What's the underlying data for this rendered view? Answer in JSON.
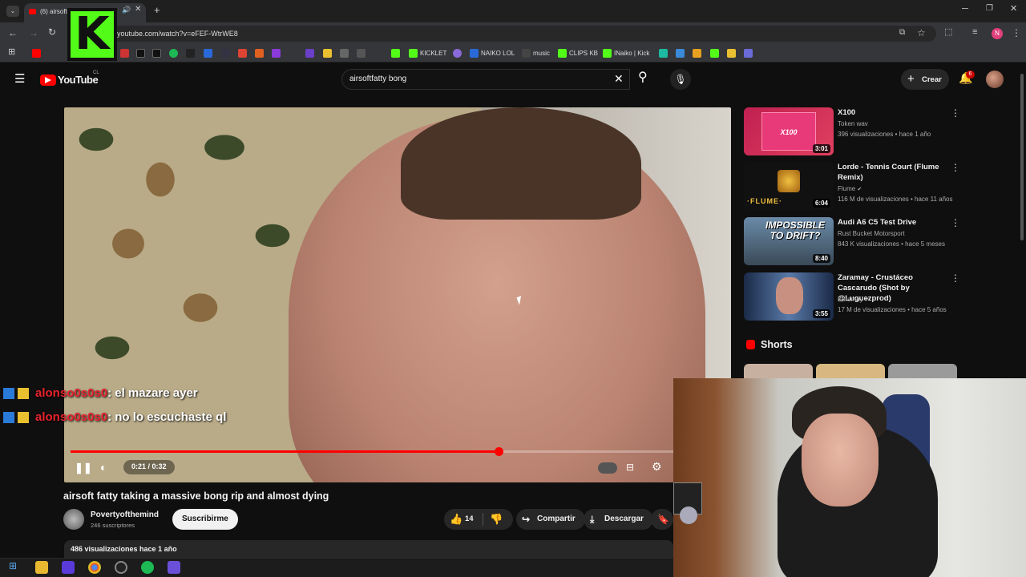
{
  "browser": {
    "tab_title": "(6) airsoft fatty taking",
    "url": "youtube.com/watch?v=eFEF-WtrWE8",
    "avatar_letter": "N",
    "bookmarks": [
      "KICKLET",
      "NAIKO LOL",
      "music",
      "CLIPS KB",
      "INaiko | Kick"
    ]
  },
  "youtube": {
    "logo_text": "YouTube",
    "logo_region": "CL",
    "search_query": "airsoftfatty bong",
    "create_label": "Crear",
    "notification_count": "6"
  },
  "player": {
    "time_display": "0:21 / 0:32",
    "progress_fraction": 0.71
  },
  "chat": [
    {
      "user": "alonso0s0s0",
      "message": ": el mazare ayer"
    },
    {
      "user": "alonso0s0s0",
      "message": ": no lo escuchaste ql"
    }
  ],
  "video": {
    "title": "airsoft fatty taking a massive bong rip and almost dying",
    "channel": "Povertyofthemind",
    "subscribers": "246 suscriptores",
    "subscribe_label": "Suscribirme",
    "likes": "14",
    "share_label": "Compartir",
    "download_label": "Descargar",
    "views_line": "486 visualizaciones  hace 1 año"
  },
  "recommendations": [
    {
      "title": "X100",
      "channel": "Token wav",
      "meta": "396 visualizaciones • hace 1 año",
      "duration": "3:01",
      "thumb_text": "X100"
    },
    {
      "title": "Lorde - Tennis Court (Flume Remix)",
      "channel": "Flume",
      "meta": "116 M de visualizaciones • hace 11 años",
      "duration": "6:04",
      "thumb_text": "·FLUME·"
    },
    {
      "title": "Audi A6 C5 Test Drive",
      "channel": "Rust Bucket Motorsport",
      "meta": "843 K visualizaciones • hace 5 meses",
      "duration": "8:40",
      "thumb_text": "IMPOSSIBLE TO DRIFT?"
    },
    {
      "title": "Zaramay - Crustáceo Cascarudo (Shot by @Luguezprod)",
      "channel": "Zaramay",
      "meta": "17 M de visualizaciones • hace 5 años",
      "duration": "3:55",
      "thumb_text": ""
    }
  ],
  "shorts_label": "Shorts",
  "stream_overlay": {
    "logo_letter": "K"
  }
}
